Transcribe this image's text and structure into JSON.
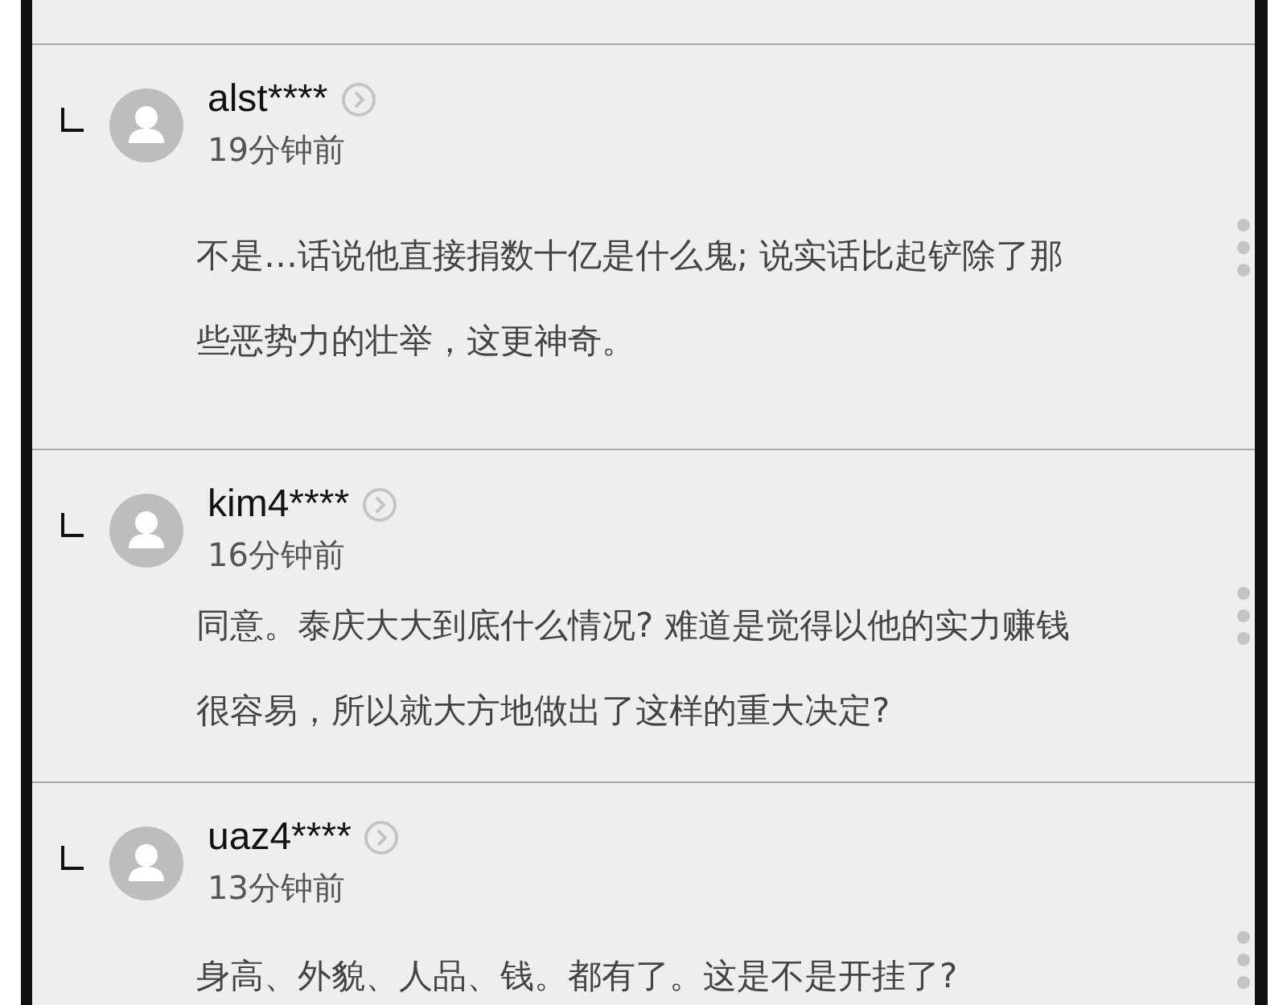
{
  "comments": [
    {
      "user": "alst****",
      "time": "19分钟前",
      "lines": [
        "不是…话说他直接捐数十亿是什么鬼; 说实话比起铲除了那",
        "些恶势力的壮举，这更神奇。"
      ]
    },
    {
      "user": "kim4****",
      "time": "16分钟前",
      "lines": [
        "同意。泰庆大大到底什么情况? 难道是觉得以他的实力赚钱",
        "很容易，所以就大方地做出了这样的重大决定?"
      ]
    },
    {
      "user": "uaz4****",
      "time": "13分钟前",
      "lines": [
        "身高、外貌、人品、钱。都有了。这是不是开挂了?"
      ]
    }
  ]
}
